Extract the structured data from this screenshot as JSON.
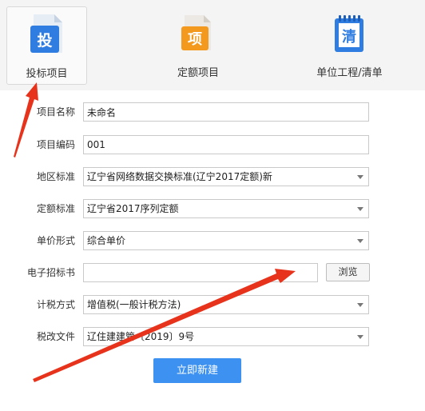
{
  "tabs": [
    {
      "label": "投标项目",
      "icon": "bid-document-icon",
      "icon_glyph": "投"
    },
    {
      "label": "定额项目",
      "icon": "quota-document-icon",
      "icon_glyph": "项"
    },
    {
      "label": "单位工程/清单",
      "icon": "bill-notebook-icon",
      "icon_glyph": "清"
    }
  ],
  "form": {
    "project_name": {
      "label": "项目名称",
      "value": "未命名"
    },
    "project_code": {
      "label": "项目编码",
      "value": "001"
    },
    "region_standard": {
      "label": "地区标准",
      "value": "辽宁省网络数据交换标准(辽宁2017定额)新"
    },
    "quota_standard": {
      "label": "定额标准",
      "value": "辽宁省2017序列定额"
    },
    "unit_price_form": {
      "label": "单价形式",
      "value": "综合单价"
    },
    "e_tender_doc": {
      "label": "电子招标书",
      "value": "",
      "browse_label": "浏览"
    },
    "tax_method": {
      "label": "计税方式",
      "value": "增值税(一般计税方法)"
    },
    "tax_reform_doc": {
      "label": "税改文件",
      "value": "辽住建建管〔2019〕9号"
    }
  },
  "create_button": "立即新建",
  "colors": {
    "primary": "#3d92f1",
    "annotation_arrow": "#e8331c",
    "tab_icon_blue": "#2f7de1",
    "tab_icon_orange": "#f39a1e"
  }
}
